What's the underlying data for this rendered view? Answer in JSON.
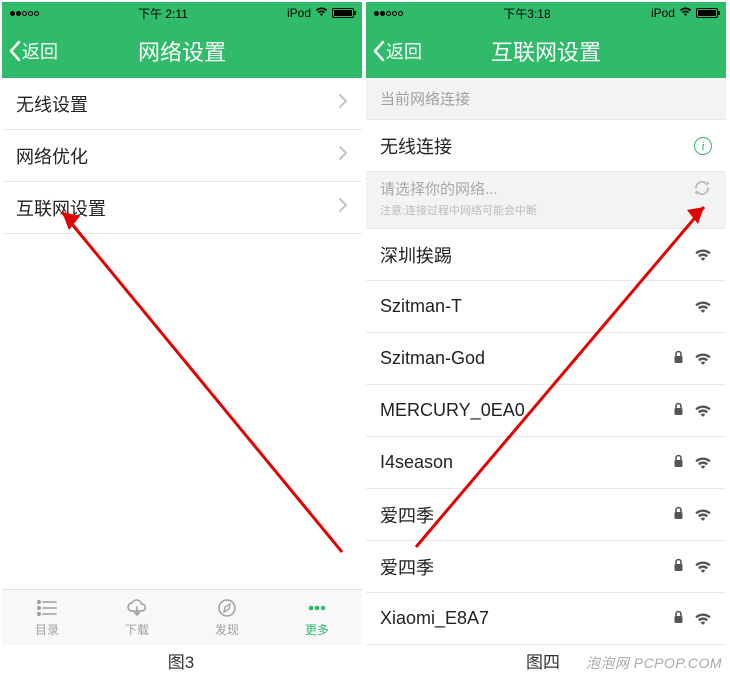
{
  "watermark": "泡泡网 PCPOP.COM",
  "left": {
    "status": {
      "time": "下午 2:11",
      "device": "iPod"
    },
    "nav": {
      "back": "返回",
      "title": "网络设置"
    },
    "items": [
      {
        "label": "无线设置"
      },
      {
        "label": "网络优化"
      },
      {
        "label": "互联网设置"
      }
    ],
    "tabs": [
      {
        "label": "目录"
      },
      {
        "label": "下载"
      },
      {
        "label": "发现"
      },
      {
        "label": "更多"
      }
    ],
    "caption": "图3"
  },
  "right": {
    "status": {
      "time": "下午3:18",
      "device": "iPod"
    },
    "nav": {
      "back": "返回",
      "title": "互联网设置"
    },
    "section1": "当前网络连接",
    "conn_label": "无线连接",
    "picker_title": "请选择你的网络...",
    "picker_note": "注意:连接过程中网络可能会中断",
    "networks": [
      {
        "name": "深圳挨踢",
        "locked": false
      },
      {
        "name": "Szitman-T",
        "locked": false
      },
      {
        "name": "Szitman-God",
        "locked": true
      },
      {
        "name": "MERCURY_0EA0",
        "locked": true
      },
      {
        "name": "I4season",
        "locked": true
      },
      {
        "name": "爱四季",
        "locked": true
      },
      {
        "name": "爱四季",
        "locked": true
      },
      {
        "name": "Xiaomi_E8A7",
        "locked": true
      }
    ],
    "caption": "图四"
  }
}
